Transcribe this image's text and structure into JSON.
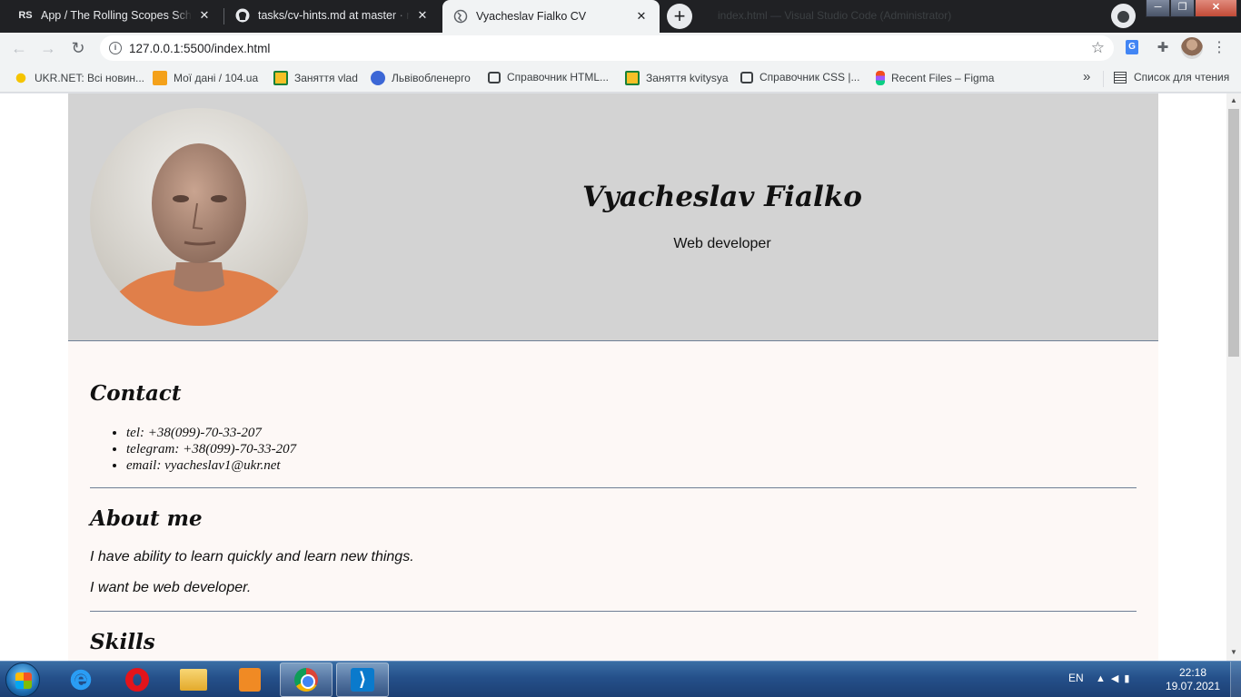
{
  "browser": {
    "tabs": [
      {
        "title": "App / The Rolling Scopes School",
        "favicon": "RS",
        "active": false
      },
      {
        "title": "tasks/cv-hints.md at master · rolling-scopes-school",
        "favicon": "github-icon",
        "active": false
      },
      {
        "title": "Vyacheslav Fialko CV",
        "favicon": "globe-icon",
        "active": true
      }
    ],
    "new_tab_label": "+",
    "ghost_title": "index.html — Visual Studio Code (Administrator)",
    "address": "127.0.0.1:5500/index.html",
    "bookmarks": [
      {
        "label": "UKR.NET: Всі новин...",
        "icon": "ukr-net-icon"
      },
      {
        "label": "Мої дані / 104.ua",
        "icon": "104ua-icon"
      },
      {
        "label": "Заняття vlad",
        "icon": "classroom-icon"
      },
      {
        "label": "Львівобленерго",
        "icon": "lvivoblenergo-icon"
      },
      {
        "label": "Справочник HTML...",
        "icon": "bookmark-bubble-icon"
      },
      {
        "label": "Заняття kvitysya",
        "icon": "classroom-icon"
      },
      {
        "label": "Справочник CSS |...",
        "icon": "bookmark-bubble-icon"
      },
      {
        "label": "Recent Files – Figma",
        "icon": "figma-icon"
      }
    ],
    "bookmarks_more": "»",
    "reading_list": "Список для чтения"
  },
  "cv": {
    "name": "Vyacheslav Fialko",
    "role": "Web developer",
    "contact_title": "Contact",
    "contacts": [
      "tel: +38(099)-70-33-207",
      "telegram: +38(099)-70-33-207",
      "email: vyacheslav1@ukr.net"
    ],
    "about_title": "About me",
    "about": [
      "I have ability to learn quickly and learn new things.",
      "I want be web developer."
    ],
    "skills_title": "Skills"
  },
  "taskbar": {
    "apps": [
      "internet-explorer-icon",
      "opera-icon",
      "file-explorer-icon",
      "media-player-icon",
      "chrome-icon",
      "vscode-icon"
    ],
    "language": "EN",
    "time": "22:18",
    "date": "19.07.2021"
  },
  "colors": {
    "header_bg": "#d3d3d3",
    "main_bg": "#fdf8f6",
    "divider": "#6f7f95"
  }
}
